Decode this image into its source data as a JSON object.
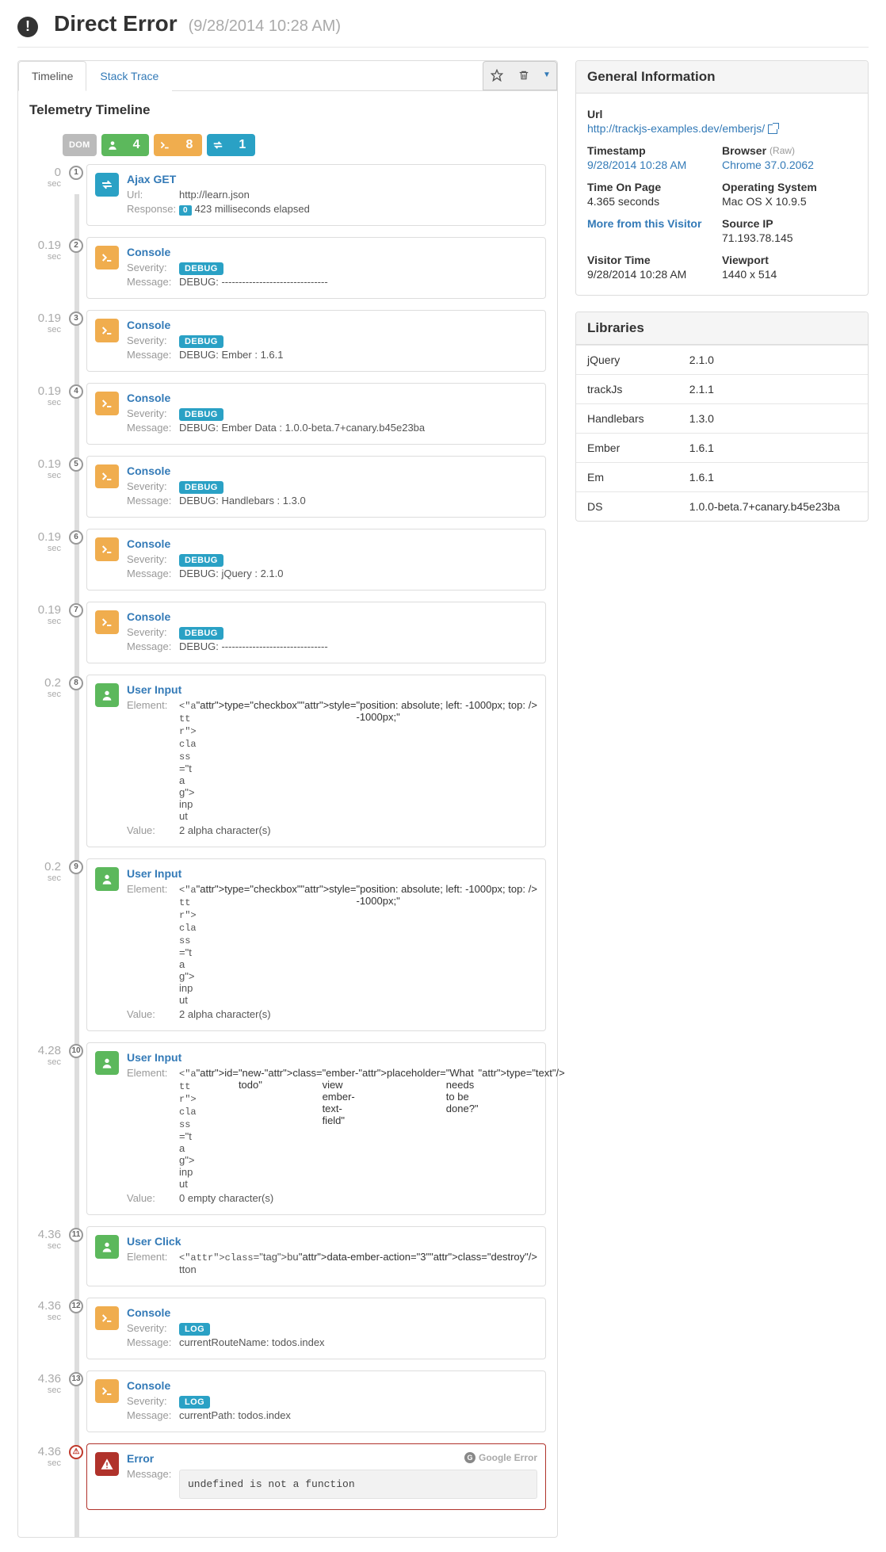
{
  "header": {
    "title": "Direct Error",
    "timestamp": "(9/28/2014 10:28 AM)"
  },
  "tabs": {
    "timeline": "Timeline",
    "stack": "Stack Trace"
  },
  "panelTitle": "Telemetry Timeline",
  "filters": {
    "dom": "DOM",
    "user": "4",
    "console": "8",
    "ajax": "1"
  },
  "events": [
    {
      "n": 1,
      "time": "0",
      "unit": "sec",
      "type": "ajax",
      "title": "Ajax GET",
      "fields": [
        {
          "k": "Url:",
          "v": "http://learn.json"
        },
        {
          "k": "Response:",
          "badge": "0",
          "v": "423 milliseconds elapsed"
        }
      ]
    },
    {
      "n": 2,
      "time": "0.19",
      "unit": "sec",
      "type": "console",
      "title": "Console",
      "fields": [
        {
          "k": "Severity:",
          "pill": "DEBUG"
        },
        {
          "k": "Message:",
          "v": "DEBUG: -------------------------------"
        }
      ]
    },
    {
      "n": 3,
      "time": "0.19",
      "unit": "sec",
      "type": "console",
      "title": "Console",
      "fields": [
        {
          "k": "Severity:",
          "pill": "DEBUG"
        },
        {
          "k": "Message:",
          "v": "DEBUG: Ember      : 1.6.1"
        }
      ]
    },
    {
      "n": 4,
      "time": "0.19",
      "unit": "sec",
      "type": "console",
      "title": "Console",
      "fields": [
        {
          "k": "Severity:",
          "pill": "DEBUG"
        },
        {
          "k": "Message:",
          "v": "DEBUG: Ember Data : 1.0.0-beta.7+canary.b45e23ba"
        }
      ]
    },
    {
      "n": 5,
      "time": "0.19",
      "unit": "sec",
      "type": "console",
      "title": "Console",
      "fields": [
        {
          "k": "Severity:",
          "pill": "DEBUG"
        },
        {
          "k": "Message:",
          "v": "DEBUG: Handlebars : 1.3.0"
        }
      ]
    },
    {
      "n": 6,
      "time": "0.19",
      "unit": "sec",
      "type": "console",
      "title": "Console",
      "fields": [
        {
          "k": "Severity:",
          "pill": "DEBUG"
        },
        {
          "k": "Message:",
          "v": "DEBUG: jQuery     : 2.1.0"
        }
      ]
    },
    {
      "n": 7,
      "time": "0.19",
      "unit": "sec",
      "type": "console",
      "title": "Console",
      "fields": [
        {
          "k": "Severity:",
          "pill": "DEBUG"
        },
        {
          "k": "Message:",
          "v": "DEBUG: -------------------------------"
        }
      ]
    },
    {
      "n": 8,
      "time": "0.2",
      "unit": "sec",
      "type": "user",
      "title": "User Input",
      "fields": [
        {
          "k": "Element:",
          "html": "<input type=\"checkbox\" style=\"position: absolute; left: -1000px; top: -1000px;\" />"
        },
        {
          "k": "Value:",
          "v": "2 alpha character(s)"
        }
      ]
    },
    {
      "n": 9,
      "time": "0.2",
      "unit": "sec",
      "type": "user",
      "title": "User Input",
      "fields": [
        {
          "k": "Element:",
          "html": "<input type=\"checkbox\" style=\"position: absolute; left: -1000px; top: -1000px;\" />"
        },
        {
          "k": "Value:",
          "v": "2 alpha character(s)"
        }
      ]
    },
    {
      "n": 10,
      "time": "4.28",
      "unit": "sec",
      "type": "user",
      "title": "User Input",
      "fields": [
        {
          "k": "Element:",
          "html": "<input id=\"new-todo\" class=\"ember-view ember-text-field\" placeholder=\"What needs to be done?\" type=\"text\" />"
        },
        {
          "k": "Value:",
          "v": "0 empty character(s)"
        }
      ]
    },
    {
      "n": 11,
      "time": "4.36",
      "unit": "sec",
      "type": "user",
      "title": "User Click",
      "fields": [
        {
          "k": "Element:",
          "html": "<button data-ember-action=\"3\" class=\"destroy\" />"
        }
      ]
    },
    {
      "n": 12,
      "time": "4.36",
      "unit": "sec",
      "type": "console",
      "title": "Console",
      "fields": [
        {
          "k": "Severity:",
          "pill": "LOG"
        },
        {
          "k": "Message:",
          "v": "currentRouteName: todos.index"
        }
      ]
    },
    {
      "n": 13,
      "time": "4.36",
      "unit": "sec",
      "type": "console",
      "title": "Console",
      "fields": [
        {
          "k": "Severity:",
          "pill": "LOG"
        },
        {
          "k": "Message:",
          "v": "currentPath: todos.index"
        }
      ]
    },
    {
      "n": "!",
      "time": "4.36",
      "unit": "sec",
      "type": "error",
      "title": "Error",
      "google": "Google Error",
      "fields": [
        {
          "k": "Message:",
          "box": "undefined is not a function"
        }
      ]
    }
  ],
  "info": {
    "header": "General Information",
    "items": {
      "url_lbl": "Url",
      "url": "http://trackjs-examples.dev/emberjs/",
      "ts_lbl": "Timestamp",
      "ts": "9/28/2014 10:28 AM",
      "browser_lbl": "Browser",
      "browser_raw": "(Raw)",
      "browser": "Chrome 37.0.2062",
      "top_lbl": "Time On Page",
      "top": "4.365 seconds",
      "os_lbl": "Operating System",
      "os": "Mac OS X 10.9.5",
      "more_lbl": "More from this Visitor",
      "ip_lbl": "Source IP",
      "ip": "71.193.78.145",
      "vt_lbl": "Visitor Time",
      "vt": "9/28/2014 10:28 AM",
      "vp_lbl": "Viewport",
      "vp": "1440 x 514"
    }
  },
  "libs": {
    "header": "Libraries",
    "rows": [
      {
        "name": "jQuery",
        "ver": "2.1.0"
      },
      {
        "name": "trackJs",
        "ver": "2.1.1"
      },
      {
        "name": "Handlebars",
        "ver": "1.3.0"
      },
      {
        "name": "Ember",
        "ver": "1.6.1"
      },
      {
        "name": "Em",
        "ver": "1.6.1"
      },
      {
        "name": "DS",
        "ver": "1.0.0-beta.7+canary.b45e23ba"
      }
    ]
  }
}
